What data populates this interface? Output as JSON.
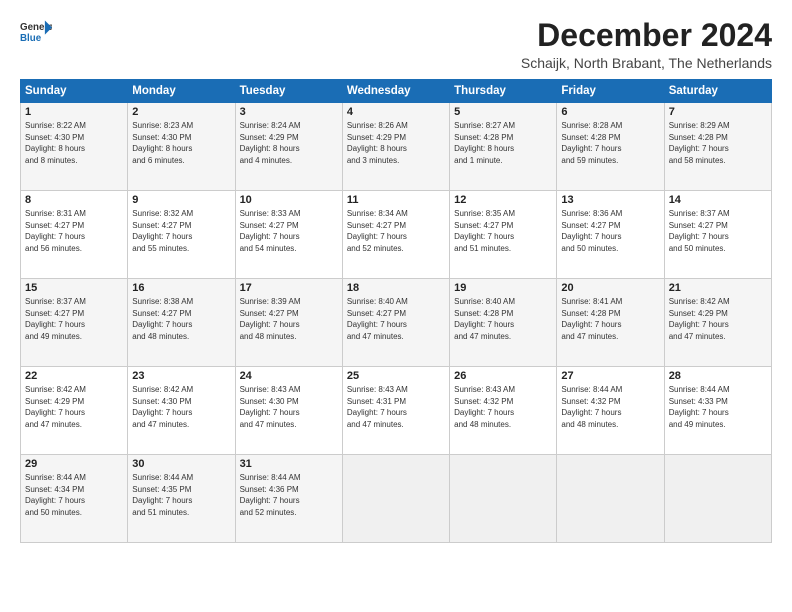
{
  "header": {
    "logo_line1": "General",
    "logo_line2": "Blue",
    "month": "December 2024",
    "location": "Schaijk, North Brabant, The Netherlands"
  },
  "days_of_week": [
    "Sunday",
    "Monday",
    "Tuesday",
    "Wednesday",
    "Thursday",
    "Friday",
    "Saturday"
  ],
  "weeks": [
    [
      {
        "day": "1",
        "content": "Sunrise: 8:22 AM\nSunset: 4:30 PM\nDaylight: 8 hours\nand 8 minutes."
      },
      {
        "day": "2",
        "content": "Sunrise: 8:23 AM\nSunset: 4:30 PM\nDaylight: 8 hours\nand 6 minutes."
      },
      {
        "day": "3",
        "content": "Sunrise: 8:24 AM\nSunset: 4:29 PM\nDaylight: 8 hours\nand 4 minutes."
      },
      {
        "day": "4",
        "content": "Sunrise: 8:26 AM\nSunset: 4:29 PM\nDaylight: 8 hours\nand 3 minutes."
      },
      {
        "day": "5",
        "content": "Sunrise: 8:27 AM\nSunset: 4:28 PM\nDaylight: 8 hours\nand 1 minute."
      },
      {
        "day": "6",
        "content": "Sunrise: 8:28 AM\nSunset: 4:28 PM\nDaylight: 7 hours\nand 59 minutes."
      },
      {
        "day": "7",
        "content": "Sunrise: 8:29 AM\nSunset: 4:28 PM\nDaylight: 7 hours\nand 58 minutes."
      }
    ],
    [
      {
        "day": "8",
        "content": "Sunrise: 8:31 AM\nSunset: 4:27 PM\nDaylight: 7 hours\nand 56 minutes."
      },
      {
        "day": "9",
        "content": "Sunrise: 8:32 AM\nSunset: 4:27 PM\nDaylight: 7 hours\nand 55 minutes."
      },
      {
        "day": "10",
        "content": "Sunrise: 8:33 AM\nSunset: 4:27 PM\nDaylight: 7 hours\nand 54 minutes."
      },
      {
        "day": "11",
        "content": "Sunrise: 8:34 AM\nSunset: 4:27 PM\nDaylight: 7 hours\nand 52 minutes."
      },
      {
        "day": "12",
        "content": "Sunrise: 8:35 AM\nSunset: 4:27 PM\nDaylight: 7 hours\nand 51 minutes."
      },
      {
        "day": "13",
        "content": "Sunrise: 8:36 AM\nSunset: 4:27 PM\nDaylight: 7 hours\nand 50 minutes."
      },
      {
        "day": "14",
        "content": "Sunrise: 8:37 AM\nSunset: 4:27 PM\nDaylight: 7 hours\nand 50 minutes."
      }
    ],
    [
      {
        "day": "15",
        "content": "Sunrise: 8:37 AM\nSunset: 4:27 PM\nDaylight: 7 hours\nand 49 minutes."
      },
      {
        "day": "16",
        "content": "Sunrise: 8:38 AM\nSunset: 4:27 PM\nDaylight: 7 hours\nand 48 minutes."
      },
      {
        "day": "17",
        "content": "Sunrise: 8:39 AM\nSunset: 4:27 PM\nDaylight: 7 hours\nand 48 minutes."
      },
      {
        "day": "18",
        "content": "Sunrise: 8:40 AM\nSunset: 4:27 PM\nDaylight: 7 hours\nand 47 minutes."
      },
      {
        "day": "19",
        "content": "Sunrise: 8:40 AM\nSunset: 4:28 PM\nDaylight: 7 hours\nand 47 minutes."
      },
      {
        "day": "20",
        "content": "Sunrise: 8:41 AM\nSunset: 4:28 PM\nDaylight: 7 hours\nand 47 minutes."
      },
      {
        "day": "21",
        "content": "Sunrise: 8:42 AM\nSunset: 4:29 PM\nDaylight: 7 hours\nand 47 minutes."
      }
    ],
    [
      {
        "day": "22",
        "content": "Sunrise: 8:42 AM\nSunset: 4:29 PM\nDaylight: 7 hours\nand 47 minutes."
      },
      {
        "day": "23",
        "content": "Sunrise: 8:42 AM\nSunset: 4:30 PM\nDaylight: 7 hours\nand 47 minutes."
      },
      {
        "day": "24",
        "content": "Sunrise: 8:43 AM\nSunset: 4:30 PM\nDaylight: 7 hours\nand 47 minutes."
      },
      {
        "day": "25",
        "content": "Sunrise: 8:43 AM\nSunset: 4:31 PM\nDaylight: 7 hours\nand 47 minutes."
      },
      {
        "day": "26",
        "content": "Sunrise: 8:43 AM\nSunset: 4:32 PM\nDaylight: 7 hours\nand 48 minutes."
      },
      {
        "day": "27",
        "content": "Sunrise: 8:44 AM\nSunset: 4:32 PM\nDaylight: 7 hours\nand 48 minutes."
      },
      {
        "day": "28",
        "content": "Sunrise: 8:44 AM\nSunset: 4:33 PM\nDaylight: 7 hours\nand 49 minutes."
      }
    ],
    [
      {
        "day": "29",
        "content": "Sunrise: 8:44 AM\nSunset: 4:34 PM\nDaylight: 7 hours\nand 50 minutes."
      },
      {
        "day": "30",
        "content": "Sunrise: 8:44 AM\nSunset: 4:35 PM\nDaylight: 7 hours\nand 51 minutes."
      },
      {
        "day": "31",
        "content": "Sunrise: 8:44 AM\nSunset: 4:36 PM\nDaylight: 7 hours\nand 52 minutes."
      },
      {
        "day": "",
        "content": ""
      },
      {
        "day": "",
        "content": ""
      },
      {
        "day": "",
        "content": ""
      },
      {
        "day": "",
        "content": ""
      }
    ]
  ]
}
